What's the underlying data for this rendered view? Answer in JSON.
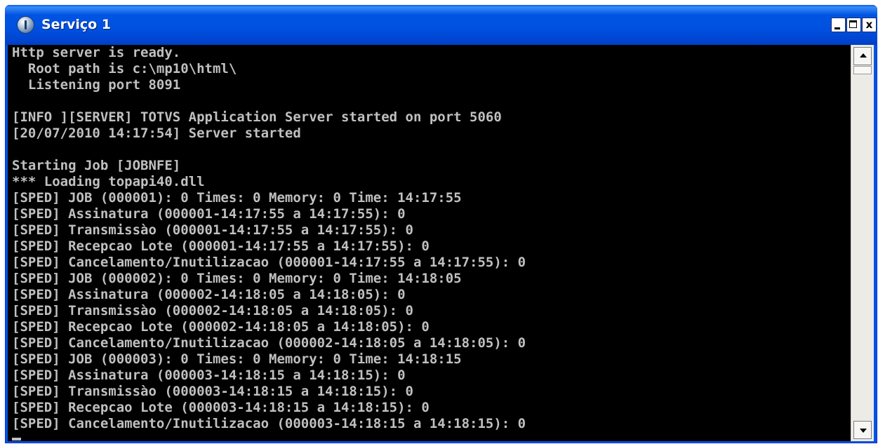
{
  "window": {
    "title": "Serviço 1",
    "icon": "service-icon"
  },
  "titlebar": {
    "buttons": {
      "minimize": "_",
      "maximize": "□",
      "close": "x"
    }
  },
  "console": {
    "background": "#000000",
    "foreground": "#c0c0c0",
    "lines": [
      "Http server is ready.",
      "  Root path is c:\\mp10\\html\\",
      "  Listening port 8091",
      "",
      "[INFO ][SERVER] TOTVS Application Server started on port 5060",
      "[20/07/2010 14:17:54] Server started",
      "",
      "Starting Job [JOBNFE]",
      "*** Loading topapi40.dll",
      "[SPED] JOB (000001): 0 Times: 0 Memory: 0 Time: 14:17:55",
      "[SPED] Assinatura (000001-14:17:55 a 14:17:55): 0",
      "[SPED] Transmissào (000001-14:17:55 a 14:17:55): 0",
      "[SPED] Recepcao Lote (000001-14:17:55 a 14:17:55): 0",
      "[SPED] Cancelamento/Inutilizacao (000001-14:17:55 a 14:17:55): 0",
      "[SPED] JOB (000002): 0 Times: 0 Memory: 0 Time: 14:18:05",
      "[SPED] Assinatura (000002-14:18:05 a 14:18:05): 0",
      "[SPED] Transmissào (000002-14:18:05 a 14:18:05): 0",
      "[SPED] Recepcao Lote (000002-14:18:05 a 14:18:05): 0",
      "[SPED] Cancelamento/Inutilizacao (000002-14:18:05 a 14:18:05): 0",
      "[SPED] JOB (000003): 0 Times: 0 Memory: 0 Time: 14:18:15",
      "[SPED] Assinatura (000003-14:18:15 a 14:18:15): 0",
      "[SPED] Transmissào (000003-14:18:15 a 14:18:15): 0",
      "[SPED] Recepcao Lote (000003-14:18:15 a 14:18:15): 0",
      "[SPED] Cancelamento/Inutilizacao (000003-14:18:15 a 14:18:15): 0"
    ]
  },
  "colors": {
    "titlebar": "#0054e3",
    "title_text": "#ffffff",
    "scrollbar": "#ecebe6"
  }
}
